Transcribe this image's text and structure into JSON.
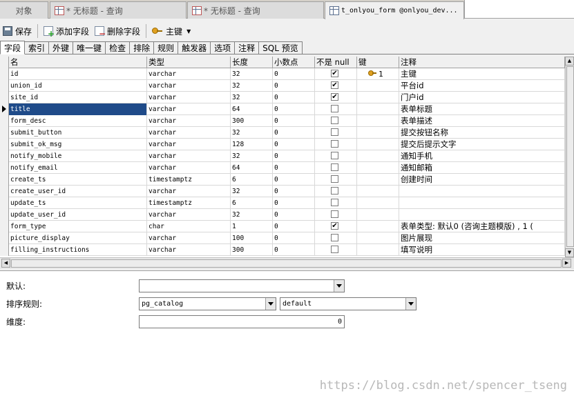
{
  "doc_tabs": [
    {
      "label": "对象",
      "icon": "none"
    },
    {
      "label": "* 无标题 - 查询",
      "icon": "query-icon"
    },
    {
      "label": "* 无标题 - 查询",
      "icon": "query-icon"
    },
    {
      "label": "t_onlyou_form @onlyou_dev...",
      "icon": "table-design-icon"
    }
  ],
  "toolbar": {
    "save": "保存",
    "add_field": "添加字段",
    "delete_field": "删除字段",
    "primary_key": "主键"
  },
  "sub_tabs": [
    "字段",
    "索引",
    "外键",
    "唯一键",
    "检查",
    "排除",
    "规则",
    "触发器",
    "选项",
    "注释",
    "SQL 预览"
  ],
  "columns": [
    "名",
    "类型",
    "长度",
    "小数点",
    "不是 null",
    "键",
    "注释"
  ],
  "fields": [
    {
      "name": "id",
      "type": "varchar",
      "length": "32",
      "decimals": "0",
      "not_null": true,
      "key": "1",
      "comment": "主键"
    },
    {
      "name": "union_id",
      "type": "varchar",
      "length": "32",
      "decimals": "0",
      "not_null": true,
      "key": "",
      "comment": "平台id"
    },
    {
      "name": "site_id",
      "type": "varchar",
      "length": "32",
      "decimals": "0",
      "not_null": true,
      "key": "",
      "comment": "门户id"
    },
    {
      "name": "title",
      "type": "varchar",
      "length": "64",
      "decimals": "0",
      "not_null": false,
      "key": "",
      "comment": "表单标题"
    },
    {
      "name": "form_desc",
      "type": "varchar",
      "length": "300",
      "decimals": "0",
      "not_null": false,
      "key": "",
      "comment": "表单描述"
    },
    {
      "name": "submit_button",
      "type": "varchar",
      "length": "32",
      "decimals": "0",
      "not_null": false,
      "key": "",
      "comment": "提交按钮名称"
    },
    {
      "name": "submit_ok_msg",
      "type": "varchar",
      "length": "128",
      "decimals": "0",
      "not_null": false,
      "key": "",
      "comment": "提交后提示文字"
    },
    {
      "name": "notify_mobile",
      "type": "varchar",
      "length": "32",
      "decimals": "0",
      "not_null": false,
      "key": "",
      "comment": "通知手机"
    },
    {
      "name": "notify_email",
      "type": "varchar",
      "length": "64",
      "decimals": "0",
      "not_null": false,
      "key": "",
      "comment": "通知邮箱"
    },
    {
      "name": "create_ts",
      "type": "timestamptz",
      "length": "6",
      "decimals": "0",
      "not_null": false,
      "key": "",
      "comment": "创建时间"
    },
    {
      "name": "create_user_id",
      "type": "varchar",
      "length": "32",
      "decimals": "0",
      "not_null": false,
      "key": "",
      "comment": ""
    },
    {
      "name": "update_ts",
      "type": "timestamptz",
      "length": "6",
      "decimals": "0",
      "not_null": false,
      "key": "",
      "comment": ""
    },
    {
      "name": "update_user_id",
      "type": "varchar",
      "length": "32",
      "decimals": "0",
      "not_null": false,
      "key": "",
      "comment": ""
    },
    {
      "name": "form_type",
      "type": "char",
      "length": "1",
      "decimals": "0",
      "not_null": true,
      "key": "",
      "comment": "表单类型: 默认0 (咨询主题模版) , 1 ("
    },
    {
      "name": "picture_display",
      "type": "varchar",
      "length": "100",
      "decimals": "0",
      "not_null": false,
      "key": "",
      "comment": "图片展现"
    },
    {
      "name": "filling_instructions",
      "type": "varchar",
      "length": "300",
      "decimals": "0",
      "not_null": false,
      "key": "",
      "comment": "填写说明"
    }
  ],
  "selected_row": 3,
  "props": {
    "default_label": "默认:",
    "default_value": "",
    "collation_label": "排序规则:",
    "collation_schema": "pg_catalog",
    "collation_value": "default",
    "dimension_label": "维度:",
    "dimension_value": "0"
  },
  "watermark": "https://blog.csdn.net/spencer_tseng",
  "colors": {
    "selection": "#1f4b89",
    "chrome": "#f0f0f0",
    "grid_line": "#d8d8d8"
  }
}
